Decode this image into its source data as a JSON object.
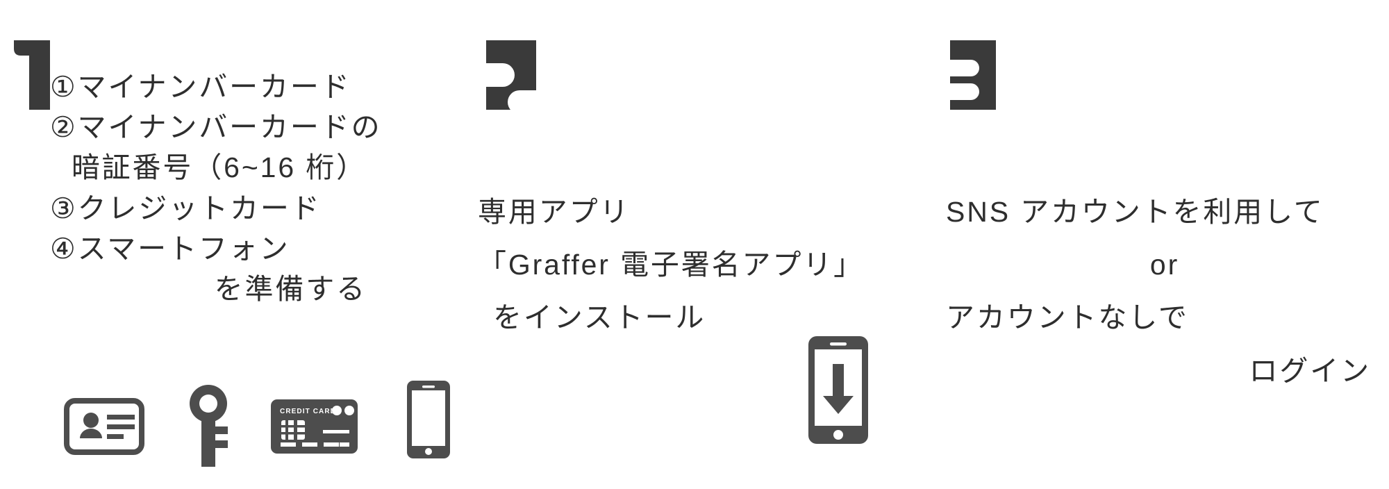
{
  "page": {
    "background_color": "#ffffff",
    "text_color": "#2e2e2e",
    "glyph_color": "#3a3a3a",
    "icon_color": "#4d4d4d"
  },
  "steps": [
    {
      "number": "1",
      "number_glyph": "step-1-block-glyph",
      "lines": [
        {
          "text": "①マイナンバーカード",
          "align": "left"
        },
        {
          "text": "②マイナンバーカードの",
          "align": "left"
        },
        {
          "text": "暗証番号（6~16 桁）",
          "align": "right"
        },
        {
          "text": "③クレジットカード",
          "align": "left"
        },
        {
          "text": "④スマートフォン",
          "align": "left"
        },
        {
          "text": "を準備する",
          "align": "right"
        }
      ],
      "icons": [
        {
          "name": "id-card-icon",
          "label": "マイナンバーカード"
        },
        {
          "name": "key-icon",
          "label": "暗証番号"
        },
        {
          "name": "credit-card-icon",
          "label": "クレジットカード",
          "face_text": "CREDIT CARD"
        },
        {
          "name": "smartphone-icon",
          "label": "スマートフォン"
        }
      ]
    },
    {
      "number": "2",
      "number_glyph": "step-2-block-glyph",
      "lines": [
        {
          "text": "専用アプリ",
          "align": "left"
        },
        {
          "text": "「Graffer 電子署名アプリ」",
          "align": "left"
        },
        {
          "text": "をインストール",
          "align": "left"
        }
      ],
      "icons": [
        {
          "name": "phone-download-icon",
          "label": "インストール"
        }
      ]
    },
    {
      "number": "3",
      "number_glyph": "step-3-block-glyph",
      "lines": [
        {
          "text": "SNS アカウントを利用して",
          "align": "left"
        },
        {
          "text": "or",
          "align": "center"
        },
        {
          "text": "アカウントなしで",
          "align": "left"
        },
        {
          "text": "ログイン",
          "align": "right"
        }
      ],
      "icons": []
    }
  ]
}
